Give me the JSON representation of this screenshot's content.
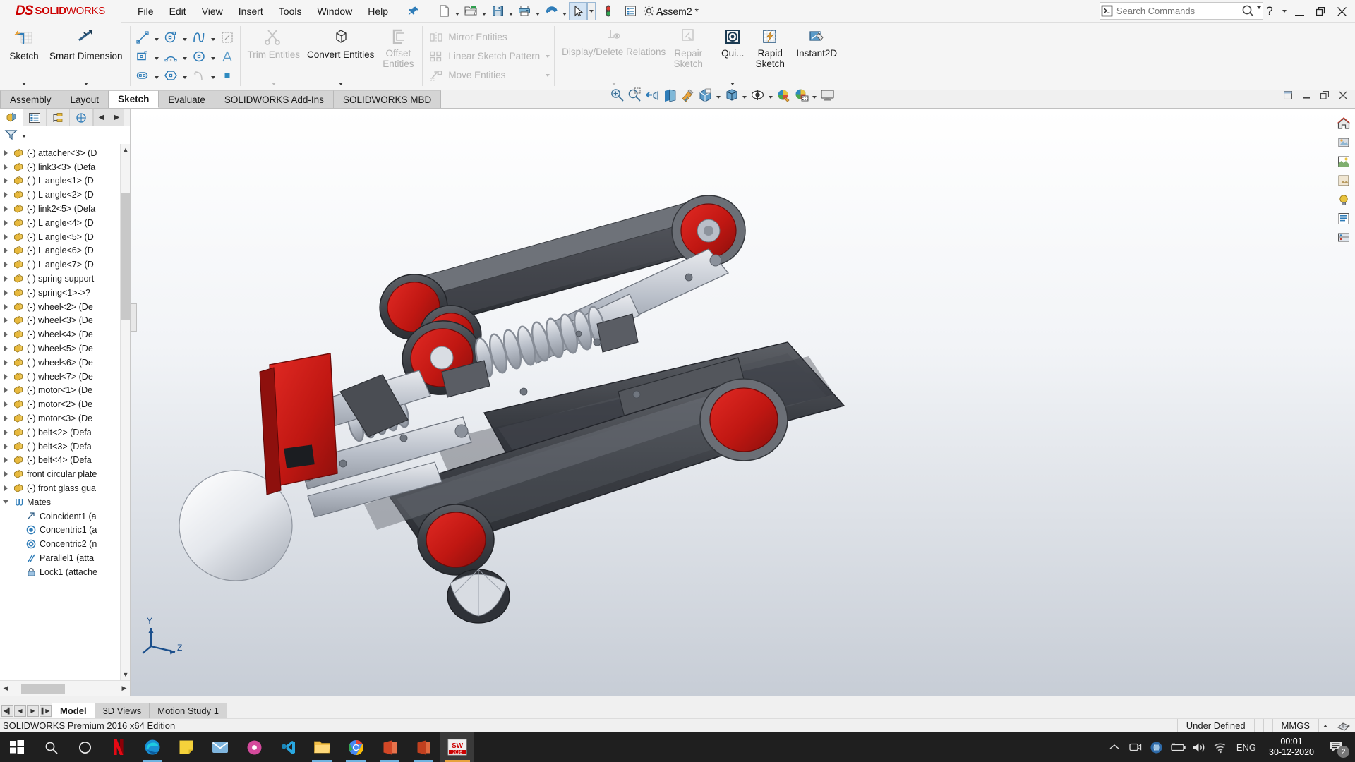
{
  "app": {
    "brand_ds": "DS",
    "brand_solid": "SOLID",
    "brand_works": "WORKS",
    "document_title": "Assem2 *",
    "brand_color": "#cc0000"
  },
  "menu": {
    "items": [
      {
        "label": "File"
      },
      {
        "label": "Edit"
      },
      {
        "label": "View"
      },
      {
        "label": "Insert"
      },
      {
        "label": "Tools"
      },
      {
        "label": "Window"
      },
      {
        "label": "Help"
      }
    ]
  },
  "quick_access": {
    "buttons": [
      {
        "name": "new-document",
        "icon": "new-doc-icon"
      },
      {
        "name": "open-document",
        "icon": "open-folder-icon"
      },
      {
        "name": "save-document",
        "icon": "save-disk-icon"
      },
      {
        "name": "print-document",
        "icon": "printer-icon"
      },
      {
        "name": "undo",
        "icon": "undo-arrow-icon"
      },
      {
        "name": "select",
        "icon": "cursor-arrow-icon"
      },
      {
        "name": "rebuild",
        "icon": "traffic-light-icon"
      },
      {
        "name": "options-list",
        "icon": "list-properties-icon"
      },
      {
        "name": "options",
        "icon": "gear-icon"
      }
    ]
  },
  "search": {
    "placeholder": "Search Commands",
    "value": ""
  },
  "window_controls": {
    "help": "?",
    "minimize": "—",
    "restore": "❐",
    "close": "✕"
  },
  "ribbon": {
    "groups": [
      {
        "name": "sketch-group",
        "big_buttons": [
          {
            "label": "Sketch",
            "icon": "sketch-icon",
            "enabled": true,
            "has_dropdown": true
          },
          {
            "label": "Smart Dimension",
            "icon": "smart-dimension-icon",
            "enabled": true,
            "has_dropdown": true
          }
        ]
      },
      {
        "name": "entities-grid",
        "mini_rows": [
          [
            {
              "icon": "line-icon",
              "dropdown": true
            },
            {
              "icon": "circle-icon",
              "dropdown": true
            },
            {
              "icon": "spline-icon",
              "dropdown": true
            },
            {
              "icon": "trim-mirror-icon",
              "dropdown": false
            }
          ],
          [
            {
              "icon": "rectangle-icon",
              "dropdown": true
            },
            {
              "icon": "arc-icon",
              "dropdown": true
            },
            {
              "icon": "ellipse-icon",
              "dropdown": true
            },
            {
              "icon": "text-icon",
              "dropdown": false
            }
          ],
          [
            {
              "icon": "slot-icon",
              "dropdown": true
            },
            {
              "icon": "polygon-icon",
              "dropdown": true
            },
            {
              "icon": "fillet-icon",
              "dropdown": true
            },
            {
              "icon": "point-icon",
              "dropdown": false
            }
          ]
        ]
      },
      {
        "name": "edit-group",
        "big_buttons": [
          {
            "label": "Trim Entities",
            "icon": "trim-entities-icon",
            "enabled": false,
            "has_dropdown": true
          },
          {
            "label": "Convert Entities",
            "icon": "convert-entities-icon",
            "enabled": true,
            "has_dropdown": true
          },
          {
            "label": "Offset Entities",
            "icon": "offset-entities-icon",
            "enabled": false,
            "has_dropdown": false
          }
        ]
      },
      {
        "name": "pattern-group",
        "text_rows": [
          {
            "label": "Mirror Entities",
            "icon": "mirror-entities-icon",
            "enabled": false,
            "dropdown": false
          },
          {
            "label": "Linear Sketch Pattern",
            "icon": "linear-pattern-icon",
            "enabled": false,
            "dropdown": true
          },
          {
            "label": "Move Entities",
            "icon": "move-entities-icon",
            "enabled": false,
            "dropdown": true
          }
        ]
      },
      {
        "name": "relations-group",
        "big_buttons": [
          {
            "label": "Display/Delete Relations",
            "icon": "display-delete-relations-icon",
            "enabled": false,
            "has_dropdown": true
          },
          {
            "label": "Repair Sketch",
            "icon": "repair-sketch-icon",
            "enabled": false,
            "has_dropdown": false
          }
        ]
      },
      {
        "name": "quick-group",
        "big_buttons": [
          {
            "label": "Qui...",
            "icon": "quick-snaps-icon",
            "enabled": true,
            "has_dropdown": true
          },
          {
            "label": "Rapid Sketch",
            "icon": "rapid-sketch-icon",
            "enabled": true,
            "has_dropdown": false
          },
          {
            "label": "Instant2D",
            "icon": "instant2d-icon",
            "enabled": true,
            "has_dropdown": false
          }
        ]
      }
    ]
  },
  "command_tabs": {
    "items": [
      {
        "label": "Assembly",
        "selected": false
      },
      {
        "label": "Layout",
        "selected": false
      },
      {
        "label": "Sketch",
        "selected": true
      },
      {
        "label": "Evaluate",
        "selected": false
      },
      {
        "label": "SOLIDWORKS Add-Ins",
        "selected": false
      },
      {
        "label": "SOLIDWORKS MBD",
        "selected": false
      }
    ]
  },
  "view_toolbar": {
    "buttons": [
      {
        "name": "zoom-to-fit-icon",
        "dropdown": false
      },
      {
        "name": "zoom-to-area-icon",
        "dropdown": false
      },
      {
        "name": "previous-view-icon",
        "dropdown": false
      },
      {
        "name": "section-view-icon",
        "dropdown": false
      },
      {
        "name": "view-orientation-paint-icon",
        "dropdown": false
      },
      {
        "name": "view-orientation-icon",
        "dropdown": true
      },
      {
        "name": "display-style-icon",
        "dropdown": true
      },
      {
        "name": "hide-show-items-icon",
        "dropdown": true
      },
      {
        "name": "edit-appearance-icon",
        "dropdown": false
      },
      {
        "name": "apply-scene-icon",
        "dropdown": true
      },
      {
        "name": "view-settings-icon",
        "dropdown": false
      }
    ],
    "window_buttons": [
      "restore-down-icon",
      "minimize-icon",
      "maximize-icon",
      "close-icon"
    ]
  },
  "feature_manager": {
    "tabs": [
      {
        "name": "feature-manager-tree-tab",
        "icon": "assembly-tree-icon",
        "selected": true
      },
      {
        "name": "property-manager-tab",
        "icon": "property-list-icon",
        "selected": false
      },
      {
        "name": "configuration-manager-tab",
        "icon": "configuration-icon",
        "selected": false
      },
      {
        "name": "display-manager-tab",
        "icon": "display-manager-icon",
        "selected": false
      }
    ],
    "filter_icon": "filter-funnel-icon",
    "tree": [
      {
        "label": "(-) attacher<3> (D",
        "icon": "component-icon",
        "expandable": true,
        "indent": 0
      },
      {
        "label": "(-) link3<3> (Defa",
        "icon": "component-icon",
        "expandable": true,
        "indent": 0
      },
      {
        "label": "(-) L angle<1> (D",
        "icon": "component-icon",
        "expandable": true,
        "indent": 0
      },
      {
        "label": "(-) L angle<2> (D",
        "icon": "component-icon",
        "expandable": true,
        "indent": 0
      },
      {
        "label": "(-) link2<5> (Defa",
        "icon": "component-icon",
        "expandable": true,
        "indent": 0
      },
      {
        "label": "(-) L angle<4> (D",
        "icon": "component-icon",
        "expandable": true,
        "indent": 0
      },
      {
        "label": "(-) L angle<5> (D",
        "icon": "component-icon",
        "expandable": true,
        "indent": 0
      },
      {
        "label": "(-) L angle<6> (D",
        "icon": "component-icon",
        "expandable": true,
        "indent": 0
      },
      {
        "label": "(-) L angle<7> (D",
        "icon": "component-icon",
        "expandable": true,
        "indent": 0
      },
      {
        "label": "(-) spring support",
        "icon": "component-icon",
        "expandable": true,
        "indent": 0
      },
      {
        "label": "(-) spring<1>->?",
        "icon": "component-icon",
        "expandable": true,
        "indent": 0
      },
      {
        "label": "(-) wheel<2> (De",
        "icon": "component-icon",
        "expandable": true,
        "indent": 0
      },
      {
        "label": "(-) wheel<3> (De",
        "icon": "component-icon",
        "expandable": true,
        "indent": 0
      },
      {
        "label": "(-) wheel<4> (De",
        "icon": "component-icon",
        "expandable": true,
        "indent": 0
      },
      {
        "label": "(-) wheel<5> (De",
        "icon": "component-icon",
        "expandable": true,
        "indent": 0
      },
      {
        "label": "(-) wheel<6> (De",
        "icon": "component-icon",
        "expandable": true,
        "indent": 0
      },
      {
        "label": "(-) wheel<7> (De",
        "icon": "component-icon",
        "expandable": true,
        "indent": 0
      },
      {
        "label": "(-) motor<1> (De",
        "icon": "component-icon",
        "expandable": true,
        "indent": 0
      },
      {
        "label": "(-) motor<2> (De",
        "icon": "component-icon",
        "expandable": true,
        "indent": 0
      },
      {
        "label": "(-) motor<3> (De",
        "icon": "component-icon",
        "expandable": true,
        "indent": 0
      },
      {
        "label": "(-) belt<2> (Defa",
        "icon": "component-icon",
        "expandable": true,
        "indent": 0
      },
      {
        "label": "(-) belt<3> (Defa",
        "icon": "component-icon",
        "expandable": true,
        "indent": 0
      },
      {
        "label": "(-) belt<4> (Defa",
        "icon": "component-icon",
        "expandable": true,
        "indent": 0
      },
      {
        "label": "front circular plate",
        "icon": "component-icon",
        "expandable": true,
        "indent": 0
      },
      {
        "label": "(-) front glass gua",
        "icon": "component-icon",
        "expandable": true,
        "indent": 0
      },
      {
        "label": "Mates",
        "icon": "mates-folder-icon",
        "expandable": true,
        "expanded": true,
        "indent": 0
      },
      {
        "label": "Coincident1 (a",
        "icon": "coincident-mate-icon",
        "expandable": false,
        "indent": 1
      },
      {
        "label": "Concentric1 (a",
        "icon": "concentric-mate-icon",
        "expandable": false,
        "indent": 1
      },
      {
        "label": "Concentric2 (n",
        "icon": "concentric-mate-icon",
        "expandable": false,
        "indent": 1
      },
      {
        "label": "Parallel1 (atta",
        "icon": "parallel-mate-icon",
        "expandable": false,
        "indent": 1
      },
      {
        "label": "Lock1 (attache",
        "icon": "lock-mate-icon",
        "expandable": false,
        "indent": 1
      }
    ]
  },
  "viewport": {
    "triad_labels": {
      "y": "Y",
      "z": "Z"
    },
    "right_tools": [
      {
        "name": "home-view-icon"
      },
      {
        "name": "appearances-icon"
      },
      {
        "name": "scenes-icon"
      },
      {
        "name": "decals-icon"
      },
      {
        "name": "lights-cameras-icon"
      },
      {
        "name": "custom-properties-icon"
      },
      {
        "name": "display-states-icon"
      }
    ]
  },
  "bottom_tabs": {
    "nav": [
      "first-page-icon",
      "previous-page-icon",
      "next-page-icon",
      "last-page-icon"
    ],
    "items": [
      {
        "label": "Model",
        "selected": true
      },
      {
        "label": "3D Views",
        "selected": false
      },
      {
        "label": "Motion Study 1",
        "selected": false
      }
    ]
  },
  "status_bar": {
    "left_text": "SOLIDWORKS Premium 2016 x64 Edition",
    "state": "Under Defined",
    "units": "MMGS",
    "units_caret": "▲",
    "editor_icon": "edit-part-icon"
  },
  "taskbar": {
    "start_icon": "windows-start-icon",
    "search_icon": "search-icon",
    "cortana_icon": "cortana-circle-icon",
    "apps": [
      {
        "name": "netflix-app",
        "glyph": "N",
        "color": "#e50914",
        "state": "none"
      },
      {
        "name": "edge-browser-app",
        "glyph": "e",
        "color": "#0c7dbb",
        "state": "open"
      },
      {
        "name": "sticky-notes-app",
        "glyph": "",
        "color": "#f5d23b",
        "state": "none"
      },
      {
        "name": "mail-app",
        "glyph": "",
        "color": "#6aa9d8",
        "state": "none"
      },
      {
        "name": "photos-app",
        "glyph": "",
        "color": "#d44a9c",
        "state": "none"
      },
      {
        "name": "vscode-app",
        "glyph": "",
        "color": "#29a7e0",
        "state": "none"
      },
      {
        "name": "file-explorer-app",
        "glyph": "",
        "color": "#f3c04a",
        "state": "open"
      },
      {
        "name": "chrome-browser-app",
        "glyph": "",
        "color": "#4688f1",
        "state": "open"
      },
      {
        "name": "office-app-one",
        "glyph": "",
        "color": "#d24726",
        "state": "open"
      },
      {
        "name": "office-app-two",
        "glyph": "",
        "color": "#d24726",
        "state": "open"
      },
      {
        "name": "solidworks-app",
        "glyph": "SW",
        "color": "#cc0000",
        "state": "active",
        "sublabel": "2016"
      }
    ],
    "tray": {
      "show_hidden": "show-hidden-icons-icon",
      "icons": [
        {
          "name": "screen-recorder-icon"
        },
        {
          "name": "dolby-audio-icon"
        },
        {
          "name": "battery-icon"
        },
        {
          "name": "volume-speaker-icon"
        },
        {
          "name": "wifi-icon"
        }
      ],
      "language": "ENG",
      "time": "00:01",
      "date": "30-12-2020",
      "notification_count": "2"
    }
  }
}
